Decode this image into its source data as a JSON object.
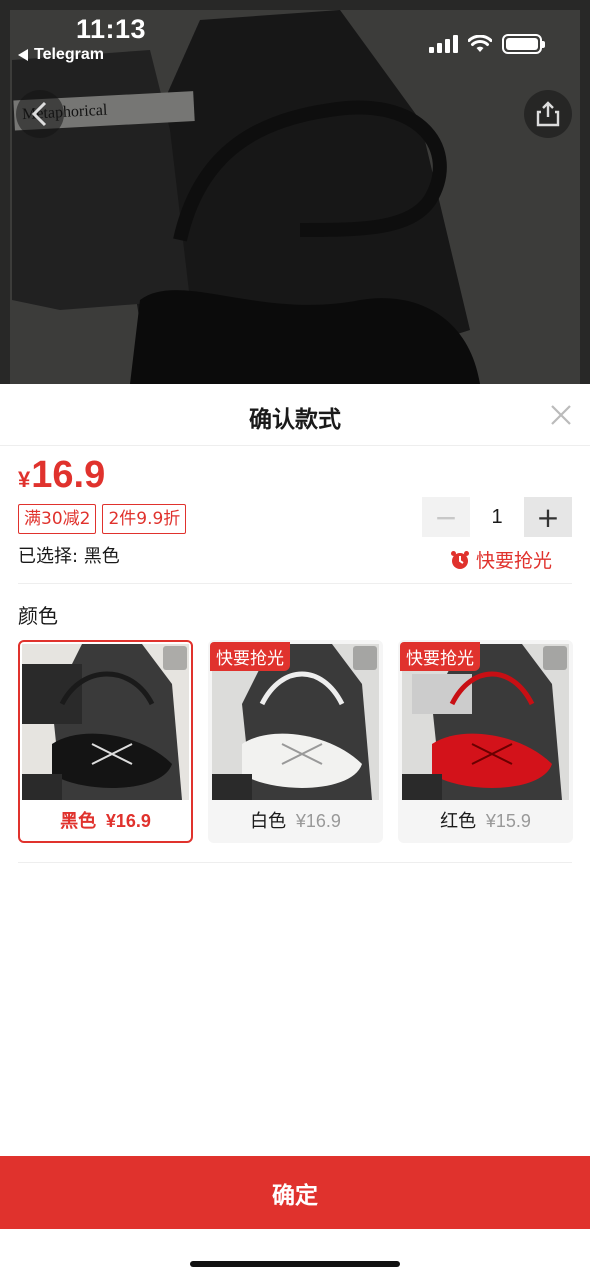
{
  "status_bar": {
    "time": "11:13",
    "back_app": "Telegram"
  },
  "sheet": {
    "title": "确认款式"
  },
  "price": {
    "currency": "¥",
    "amount": "16.9"
  },
  "promo_tags": [
    "满30减2",
    "2件9.9折"
  ],
  "selected": {
    "label": "已选择: 黑色"
  },
  "quantity": {
    "value": "1",
    "minus": "−",
    "plus": "+"
  },
  "hurry_label": "快要抢光",
  "section": {
    "label": "颜色"
  },
  "variants": [
    {
      "name": "黑色",
      "price": "¥16.9",
      "badge": "",
      "selected": true
    },
    {
      "name": "白色",
      "price": "¥16.9",
      "badge": "快要抢光",
      "selected": false
    },
    {
      "name": "红色",
      "price": "¥15.9",
      "badge": "快要抢光",
      "selected": false
    }
  ],
  "confirm_label": "确定",
  "colors": {
    "accent": "#e0322d",
    "photo_background": "#2b2b2b"
  },
  "photo_caption_brand": "Metaphorical"
}
